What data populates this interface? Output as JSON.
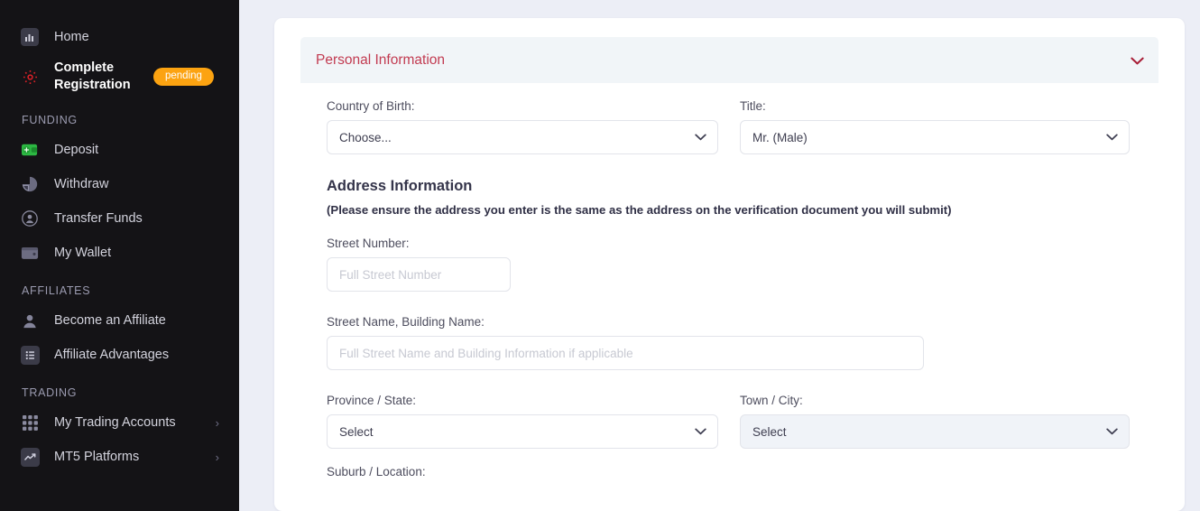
{
  "sidebar": {
    "primary_items": [
      {
        "label": "Home",
        "icon": "bar-chart-icon",
        "badge": null,
        "chevron": false
      },
      {
        "label": "Complete Registration",
        "icon": "gear-icon",
        "badge": "pending",
        "chevron": false
      }
    ],
    "groups": [
      {
        "title": "FUNDING",
        "items": [
          {
            "label": "Deposit",
            "icon": "wallet-plus-icon",
            "chevron": false
          },
          {
            "label": "Withdraw",
            "icon": "pie-chart-icon",
            "chevron": false
          },
          {
            "label": "Transfer Funds",
            "icon": "user-circle-icon",
            "chevron": false
          },
          {
            "label": "My Wallet",
            "icon": "wallet-icon",
            "chevron": false
          }
        ]
      },
      {
        "title": "AFFILIATES",
        "items": [
          {
            "label": "Become an Affiliate",
            "icon": "user-icon",
            "chevron": false
          },
          {
            "label": "Affiliate Advantages",
            "icon": "list-icon",
            "chevron": false
          }
        ]
      },
      {
        "title": "TRADING",
        "items": [
          {
            "label": "My Trading Accounts",
            "icon": "grid-icon",
            "chevron": true
          },
          {
            "label": "MT5 Platforms",
            "icon": "trend-up-icon",
            "chevron": true
          }
        ]
      }
    ],
    "chevron_glyph": "›"
  },
  "card": {
    "header": {
      "title": "Personal Information",
      "collapse_icon": "chevron-down-icon",
      "collapse_glyph": "⌄"
    },
    "fields": {
      "country_of_birth": {
        "label": "Country of Birth:",
        "value": "Choose...",
        "control": "select"
      },
      "title": {
        "label": "Title:",
        "value": "Mr. (Male)",
        "control": "select"
      },
      "street_number": {
        "label": "Street Number:",
        "value": "",
        "placeholder": "Full Street Number",
        "control": "text"
      },
      "street_name": {
        "label": "Street Name, Building Name:",
        "value": "",
        "placeholder": "Full Street Name and Building Information if applicable",
        "control": "text"
      },
      "province_state": {
        "label": "Province / State:",
        "value": "Select",
        "control": "select"
      },
      "town_city": {
        "label": "Town / City:",
        "value": "Select",
        "control": "select"
      },
      "suburb_location": {
        "label": "Suburb / Location:",
        "value": "",
        "control": "text"
      }
    },
    "address_section": {
      "heading": "Address Information",
      "note": "(Please ensure the address you enter is the same as the address on the verification document you will submit)"
    },
    "select_chevron_glyph": "⌄"
  },
  "colors": {
    "sidebar_bg": "#141316",
    "page_bg": "#eceef6",
    "accent_red": "#c23b51",
    "badge_orange": "#fca311",
    "deposit_green": "#2cb742",
    "gear_red": "#d92027"
  }
}
